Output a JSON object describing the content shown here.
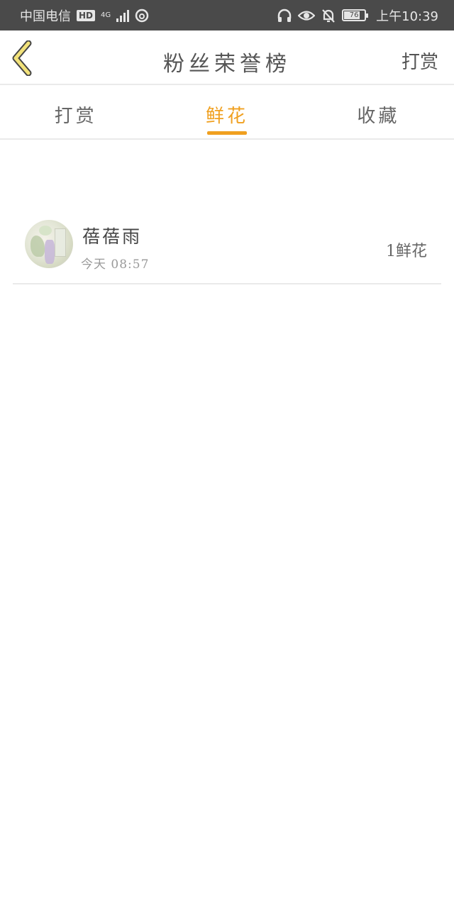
{
  "status_bar": {
    "carrier": "中国电信",
    "hd": "HD",
    "network": "4G",
    "battery": "76",
    "time": "上午10:39"
  },
  "header": {
    "title": "粉丝荣誉榜",
    "action_label": "打赏"
  },
  "tabs": [
    {
      "label": "打赏",
      "active": false
    },
    {
      "label": "鲜花",
      "active": true
    },
    {
      "label": "收藏",
      "active": false
    }
  ],
  "list": [
    {
      "name": "蓓蓓雨",
      "time": "今天 08:57",
      "count": "1鲜花"
    }
  ],
  "colors": {
    "accent": "#f0a020",
    "status_bar_bg": "#4a4a4a",
    "back_icon_fill": "#f2e27a"
  }
}
